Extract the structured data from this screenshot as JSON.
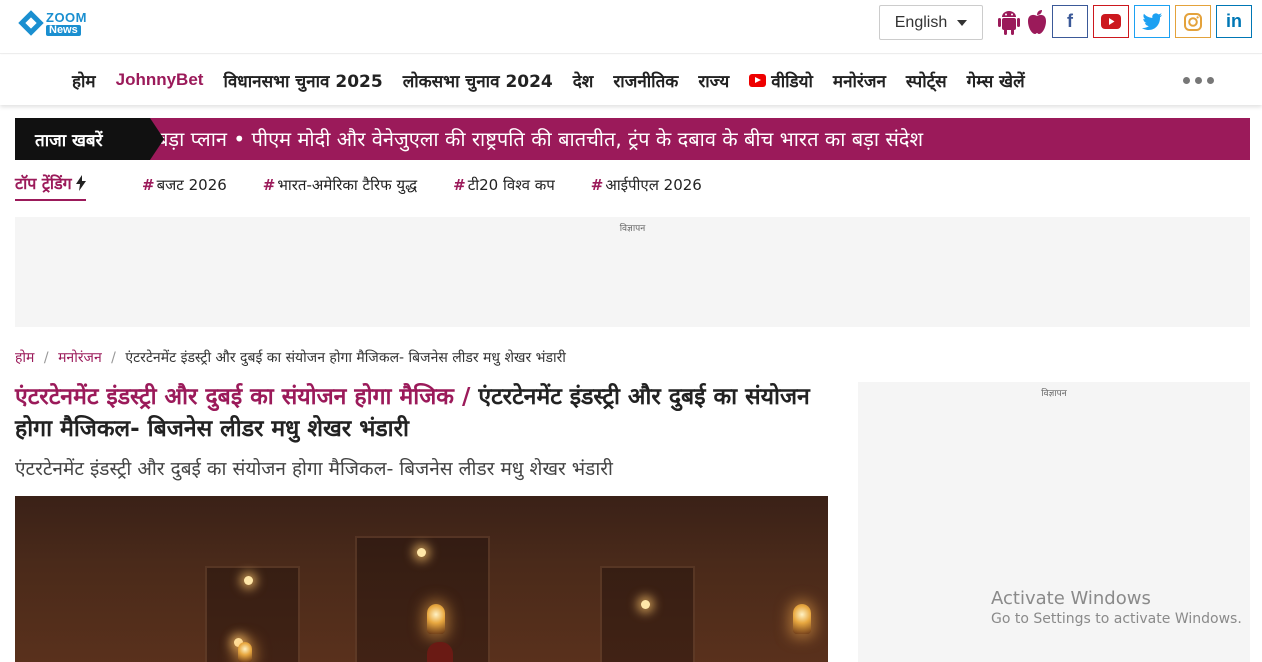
{
  "header": {
    "logo": {
      "line1": "ZOOM",
      "line2": "News"
    },
    "language": {
      "selected": "English"
    },
    "app_icons": [
      "android-icon",
      "apple-icon"
    ],
    "social": [
      {
        "name": "facebook",
        "glyph": "f",
        "color": "#3b5998"
      },
      {
        "name": "youtube",
        "color": "#cc181e"
      },
      {
        "name": "twitter",
        "color": "#1da1f2"
      },
      {
        "name": "instagram",
        "color": "#e4a23b"
      },
      {
        "name": "linkedin",
        "glyph": "in",
        "color": "#0077b5"
      }
    ]
  },
  "nav": {
    "items": [
      "होम",
      "JohnnyBet",
      "विधानसभा चुनाव 2025",
      "लोकसभा चुनाव 2024",
      "देश",
      "राजनीतिक",
      "राज्य",
      "वीडियो",
      "मनोरंजन",
      "स्पोर्ट्स",
      "गेम्स खेलें"
    ]
  },
  "ticker": {
    "label": "ताजा खबरें",
    "text": "बड़ा प्लान • पीएम मोदी और वेनेजुएला की राष्ट्रपति की बातचीत, ट्रंप के दबाव के बीच भारत का बड़ा संदेश"
  },
  "trending": {
    "title": "टॉप ट्रेंडिंग",
    "hash": "#",
    "tags": [
      "बजट 2026",
      "भारत-अमेरिका टैरिफ युद्ध",
      "टी20 विश्व कप",
      "आईपीएल 2026"
    ]
  },
  "ads": {
    "label": "विज्ञापन"
  },
  "breadcrumb": {
    "home": "होम",
    "category": "मनोरंजन",
    "current": "एंटरटेनमेंट इंडस्ट्री और दुबई का संयोजन होगा मैजिकल- बिजनेस लीडर मधु शेखर भंडारी",
    "separator": "/"
  },
  "article": {
    "title_accent": "एंटरटेनमेंट इंडस्ट्री और दुबई का संयोजन होगा मैजिक / ",
    "title_rest": "एंटरटेनमेंट इंडस्ट्री और दुबई का संयोजन होगा मैजिकल- बिजनेस लीडर मधु शेखर भंडारी",
    "subtitle": "एंटरटेनमेंट इंडस्ट्री और दुबई का संयोजन होगा मैजिकल- बिजनेस लीडर मधु शेखर भंडारी"
  },
  "watermark": {
    "title": "Activate Windows",
    "subtitle": "Go to Settings to activate Windows."
  },
  "colors": {
    "accent": "#9b1a5a",
    "ticker_label_bg": "#111111",
    "ad_bg": "#f5f5f5"
  }
}
